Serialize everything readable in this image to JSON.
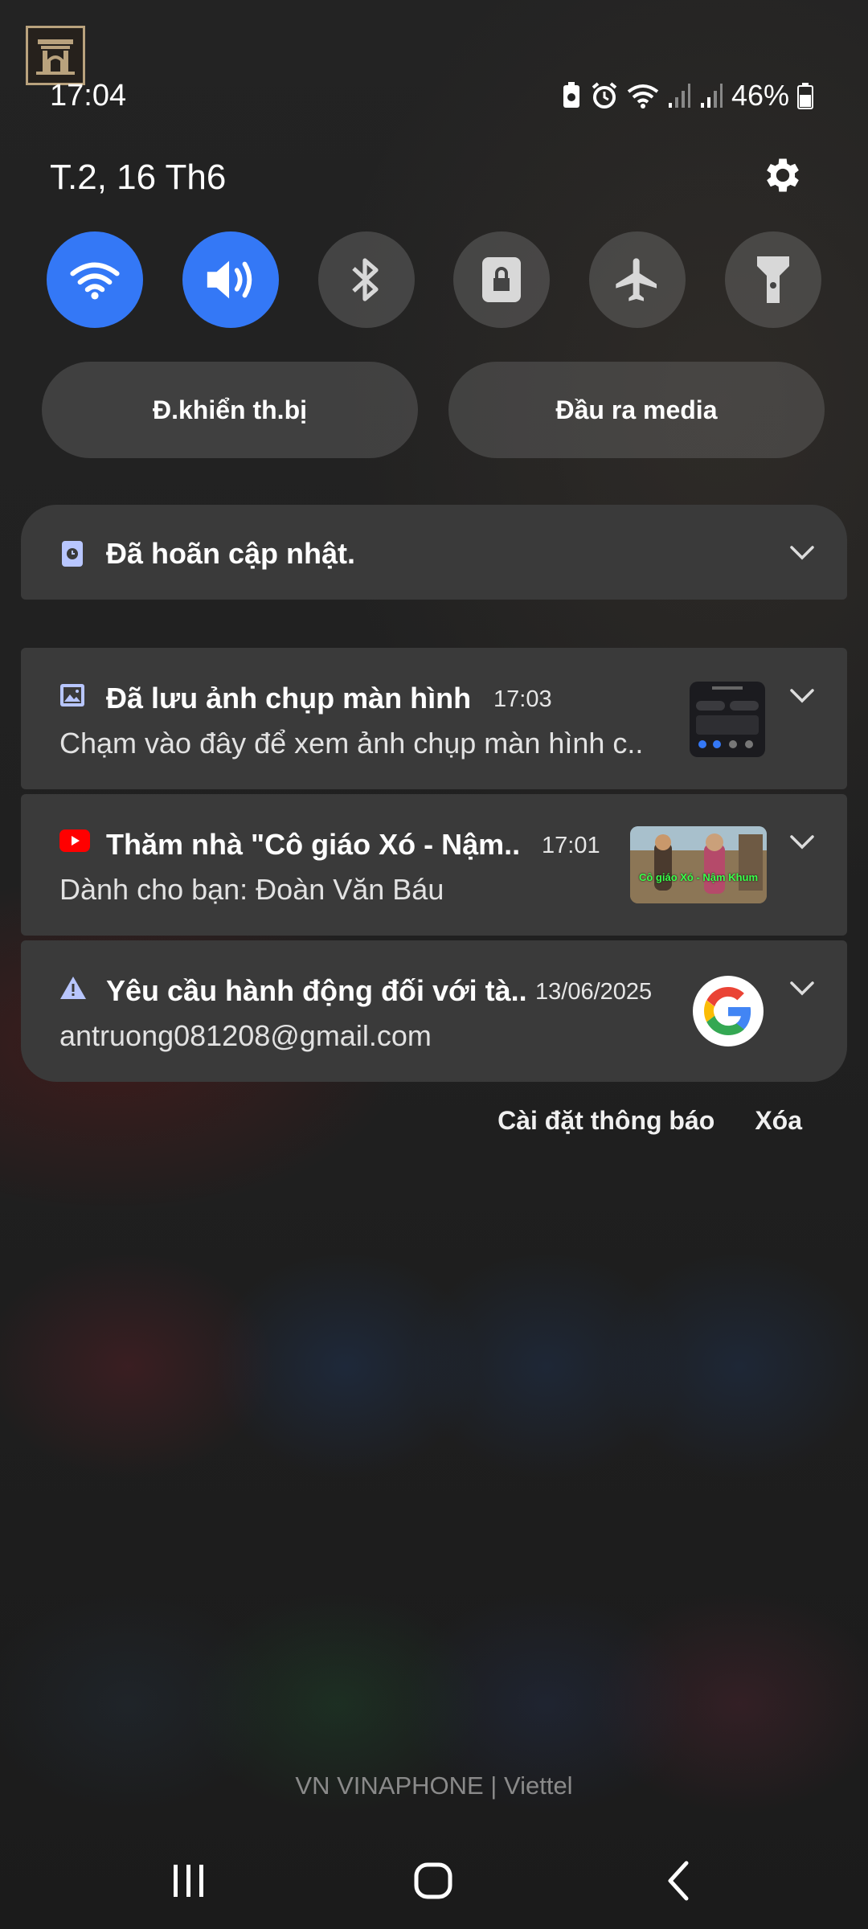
{
  "status_bar": {
    "time": "17:04",
    "battery_percent": "46%",
    "icons": [
      "battery-saver-icon",
      "alarm-icon",
      "wifi-icon",
      "signal-sim1-icon",
      "signal-sim2-icon",
      "battery-icon"
    ]
  },
  "header": {
    "date": "T.2, 16 Th6"
  },
  "quick_settings": [
    {
      "name": "wifi",
      "on": true
    },
    {
      "name": "sound",
      "on": true
    },
    {
      "name": "bluetooth",
      "on": false
    },
    {
      "name": "screen-lock",
      "on": false
    },
    {
      "name": "airplane-mode",
      "on": false
    },
    {
      "name": "flashlight",
      "on": false
    }
  ],
  "pills": {
    "device_control": "Đ.khiển th.bị",
    "media_output": "Đầu ra media"
  },
  "notifications": {
    "update": {
      "title": "Đã hoãn cập nhật."
    },
    "screenshot": {
      "title": "Đã lưu ảnh chụp màn hình",
      "time": "17:03",
      "body": "Chạm vào đây để xem ảnh chụp màn hình c.."
    },
    "youtube": {
      "title": "Thăm nhà \"Cô giáo Xó - Nậm..",
      "time": "17:01",
      "body": "Dành cho bạn: Đoàn Văn Báu",
      "thumb_caption": "Cô giáo Xó - Nậm Khum"
    },
    "google": {
      "title": "Yêu cầu hành động đối với tà..",
      "time": "13/06/2025",
      "body": "antruong081208@gmail.com"
    }
  },
  "notification_actions": {
    "settings": "Cài đặt thông báo",
    "clear": "Xóa"
  },
  "carrier_text": "VN VINAPHONE | Viettel",
  "colors": {
    "accent": "#3478f6",
    "card": "#3a3a3a",
    "youtube": "#ff0000"
  }
}
